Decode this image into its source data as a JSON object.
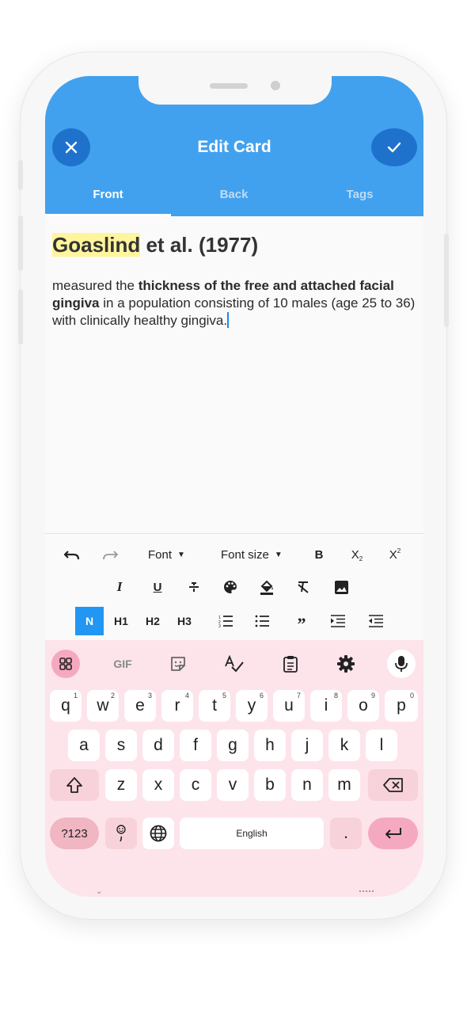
{
  "app": {
    "title": "Edit Card",
    "tabs": [
      {
        "label": "Front",
        "active": true
      },
      {
        "label": "Back",
        "active": false
      },
      {
        "label": "Tags",
        "active": false
      }
    ],
    "colors": {
      "appbar": "#42a1ee",
      "button": "#1f72cc",
      "accent": "#2196f3",
      "highlight": "#fff59d",
      "keyboard": "#fde4ea"
    }
  },
  "editor": {
    "heading_highlight": "Goaslind",
    "heading_rest": " et al. (1977)",
    "para_1": "measured the ",
    "para_bold": "thickness of the free and attached facial gingiva",
    "para_2": " in a population consisting of 10 males (age 25 to 36) with clinically healthy gingiva."
  },
  "toolbar": {
    "font_label": "Font",
    "font_size_label": "Font size",
    "bold_label": "B",
    "subscript_label": "X",
    "superscript_label": "X",
    "n_label": "N",
    "h1_label": "H1",
    "h2_label": "H2",
    "h3_label": "H3",
    "icons": [
      "undo-icon",
      "redo-icon",
      "italic-icon",
      "underline-icon",
      "strikethrough-icon",
      "palette-icon",
      "fill-color-icon",
      "clear-format-icon",
      "image-icon",
      "numbered-list-icon",
      "bullet-list-icon",
      "quote-icon",
      "indent-icon",
      "outdent-icon"
    ]
  },
  "keyboard": {
    "toolbar_gif": "GIF",
    "row1": [
      "q",
      "w",
      "e",
      "r",
      "t",
      "y",
      "u",
      "i",
      "o",
      "p"
    ],
    "row1_sup": [
      "1",
      "2",
      "3",
      "4",
      "5",
      "6",
      "7",
      "8",
      "9",
      "0"
    ],
    "row2": [
      "a",
      "s",
      "d",
      "f",
      "g",
      "h",
      "j",
      "k",
      "l"
    ],
    "row3": [
      "z",
      "x",
      "c",
      "v",
      "b",
      "n",
      "m"
    ],
    "symbols_label": "?123",
    "space_label": "English",
    "period_label": "."
  }
}
